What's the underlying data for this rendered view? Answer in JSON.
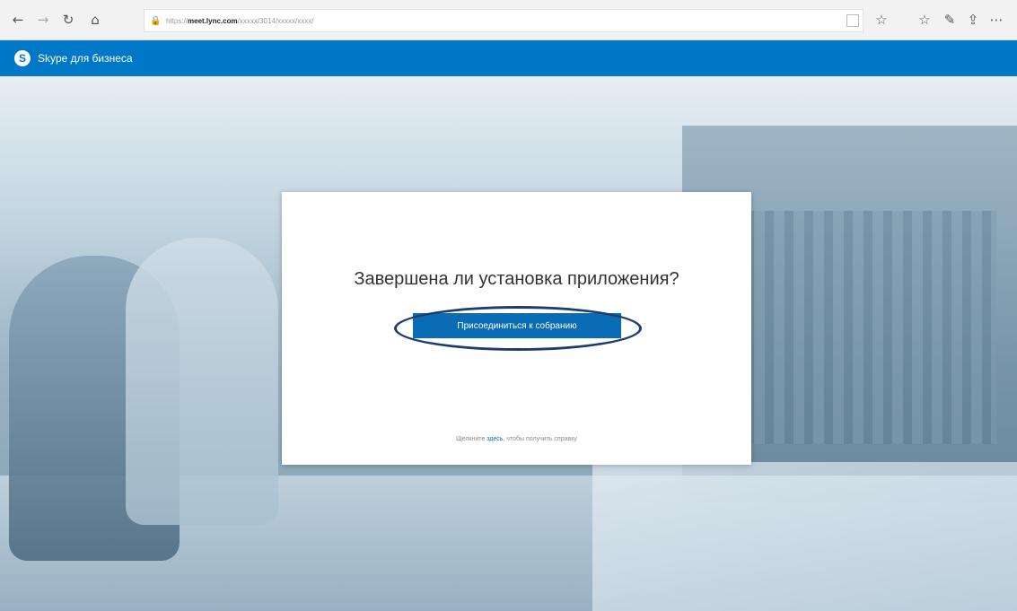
{
  "browser": {
    "url_prefix": "https://",
    "url_host": "meet.lync.com",
    "url_path": "/xxxxx/3014/xxxxx/xxxx/"
  },
  "app": {
    "title": "Skype для бизнеса",
    "logo_letter": "S"
  },
  "dialog": {
    "title": "Завершена ли установка приложения?",
    "join_button": "Присоединиться к собранию",
    "help_prefix": "Щелкните ",
    "help_link": "здесь",
    "help_suffix": ", чтобы получить справку"
  },
  "colors": {
    "accent": "#0078c8",
    "button": "#0a6cb5",
    "highlight_ring": "#1e3d6e"
  }
}
